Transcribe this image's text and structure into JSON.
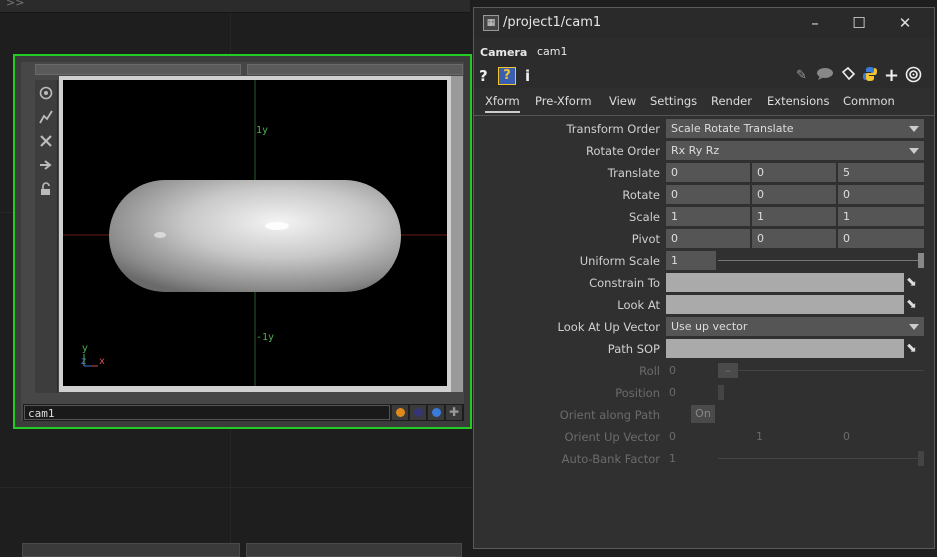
{
  "network": {
    "overflow_glyph": ">>"
  },
  "node": {
    "name": "cam1",
    "toolbar_icons": [
      "target-icon",
      "path-icon",
      "close-x-icon",
      "arrow-right-icon",
      "lock-icon"
    ],
    "flags": [
      {
        "name": "flag-orange",
        "color": "#e08a1e"
      },
      {
        "name": "flag-dark-blue",
        "color": "#353575"
      },
      {
        "name": "flag-blue",
        "color": "#3a7ad8"
      }
    ],
    "viewport": {
      "top_label": "1y",
      "bottom_label": "-1y",
      "axis_y": "y",
      "axis_x": "x",
      "axis_z": "z"
    }
  },
  "window": {
    "title": "/project1/cam1",
    "op_type": "Camera",
    "op_name": "cam1",
    "header_icons": {
      "help": "?",
      "python_help": "?",
      "info": "i"
    },
    "tabs": [
      "Xform",
      "Pre-Xform",
      "View",
      "Settings",
      "Render",
      "Extensions",
      "Common"
    ],
    "active_tab": "Xform"
  },
  "params": {
    "transform_order": {
      "label": "Transform Order",
      "value": "Scale Rotate Translate"
    },
    "rotate_order": {
      "label": "Rotate Order",
      "value": "Rx Ry Rz"
    },
    "translate": {
      "label": "Translate",
      "values": [
        "0",
        "0",
        "5"
      ]
    },
    "rotate": {
      "label": "Rotate",
      "values": [
        "0",
        "0",
        "0"
      ]
    },
    "scale": {
      "label": "Scale",
      "values": [
        "1",
        "1",
        "1"
      ]
    },
    "pivot": {
      "label": "Pivot",
      "values": [
        "0",
        "0",
        "0"
      ]
    },
    "uniform_scale": {
      "label": "Uniform Scale",
      "value": "1"
    },
    "constrain_to": {
      "label": "Constrain To"
    },
    "look_at": {
      "label": "Look At"
    },
    "look_at_up_vector": {
      "label": "Look At Up Vector",
      "value": "Use up vector"
    },
    "path_sop": {
      "label": "Path SOP"
    },
    "roll": {
      "label": "Roll",
      "value": "0",
      "knob": "–"
    },
    "position": {
      "label": "Position",
      "value": "0"
    },
    "orient_along_path": {
      "label": "Orient along Path",
      "value": "On"
    },
    "orient_up_vector": {
      "label": "Orient Up Vector",
      "values": [
        "0",
        "1",
        "0"
      ]
    },
    "auto_bank_factor": {
      "label": "Auto-Bank Factor",
      "value": "1"
    }
  }
}
